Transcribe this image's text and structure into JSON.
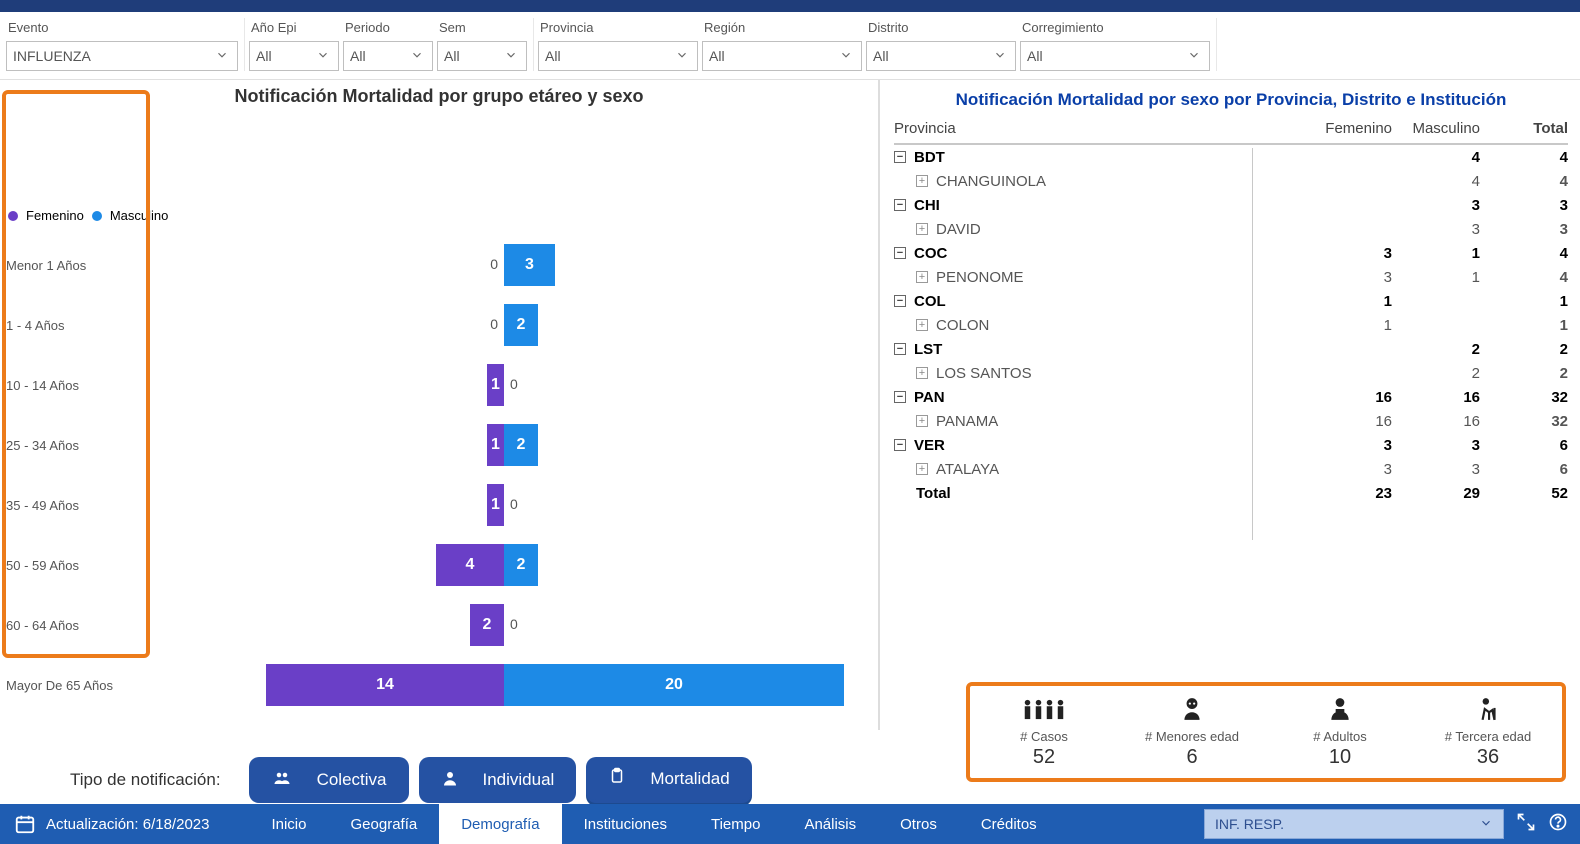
{
  "filters": {
    "evento": {
      "label": "Evento",
      "value": "INFLUENZA"
    },
    "ano": {
      "label": "Año Epi",
      "value": "All"
    },
    "periodo": {
      "label": "Periodo",
      "value": "All"
    },
    "sem": {
      "label": "Sem",
      "value": "All"
    },
    "provincia": {
      "label": "Provincia",
      "value": "All"
    },
    "region": {
      "label": "Región",
      "value": "All"
    },
    "distrito": {
      "label": "Distrito",
      "value": "All"
    },
    "corregimiento": {
      "label": "Corregimiento",
      "value": "All"
    }
  },
  "chart_title": "Notificación Mortalidad por grupo etáreo y sexo",
  "legend": {
    "f": "Femenino",
    "m": "Masculino"
  },
  "chart_data": {
    "type": "bar",
    "orientation": "diverging-horizontal",
    "title": "Notificación Mortalidad por grupo etáreo y sexo",
    "xlabel": "",
    "ylabel": "",
    "categories": [
      "Menor 1 Años",
      "1 - 4 Años",
      "10 - 14 Años",
      "25 - 34 Años",
      "35 - 49 Años",
      "50 - 59 Años",
      "60 - 64 Años",
      "Mayor De 65 Años"
    ],
    "series": [
      {
        "name": "Femenino",
        "color": "#6a3fc7",
        "values": [
          0,
          0,
          1,
          1,
          1,
          4,
          2,
          14
        ]
      },
      {
        "name": "Masculino",
        "color": "#1d8ae6",
        "values": [
          3,
          2,
          0,
          2,
          0,
          2,
          0,
          20
        ]
      }
    ]
  },
  "table_title": "Notificación Mortalidad por sexo por Provincia, Distrito e Institución",
  "table_headers": {
    "c1": "Provincia",
    "c2": "Femenino",
    "c3": "Masculino",
    "c4": "Total"
  },
  "table_rows": [
    {
      "lvl": 1,
      "name": "BDT",
      "f": "",
      "m": "4",
      "t": "4"
    },
    {
      "lvl": 2,
      "name": "CHANGUINOLA",
      "f": "",
      "m": "4",
      "t": "4"
    },
    {
      "lvl": 1,
      "name": "CHI",
      "f": "",
      "m": "3",
      "t": "3"
    },
    {
      "lvl": 2,
      "name": "DAVID",
      "f": "",
      "m": "3",
      "t": "3"
    },
    {
      "lvl": 1,
      "name": "COC",
      "f": "3",
      "m": "1",
      "t": "4"
    },
    {
      "lvl": 2,
      "name": "PENONOME",
      "f": "3",
      "m": "1",
      "t": "4"
    },
    {
      "lvl": 1,
      "name": "COL",
      "f": "1",
      "m": "",
      "t": "1"
    },
    {
      "lvl": 2,
      "name": "COLON",
      "f": "1",
      "m": "",
      "t": "1"
    },
    {
      "lvl": 1,
      "name": "LST",
      "f": "",
      "m": "2",
      "t": "2"
    },
    {
      "lvl": 2,
      "name": "LOS SANTOS",
      "f": "",
      "m": "2",
      "t": "2"
    },
    {
      "lvl": 1,
      "name": "PAN",
      "f": "16",
      "m": "16",
      "t": "32"
    },
    {
      "lvl": 2,
      "name": "PANAMA",
      "f": "16",
      "m": "16",
      "t": "32"
    },
    {
      "lvl": 1,
      "name": "VER",
      "f": "3",
      "m": "3",
      "t": "6"
    },
    {
      "lvl": 2,
      "name": "ATALAYA",
      "f": "3",
      "m": "3",
      "t": "6"
    },
    {
      "lvl": 1,
      "name": "Total",
      "f": "23",
      "m": "29",
      "t": "52",
      "is_total": true
    }
  ],
  "notif": {
    "label": "Tipo de notificación:",
    "colectiva": "Colectiva",
    "individual": "Individual",
    "mortalidad": "Mortalidad"
  },
  "kpi": {
    "casos": {
      "label": "# Casos",
      "value": "52"
    },
    "menores": {
      "label": "# Menores edad",
      "value": "6"
    },
    "adultos": {
      "label": "# Adultos",
      "value": "10"
    },
    "tercera": {
      "label": "# Tercera edad",
      "value": "36"
    }
  },
  "footer": {
    "update_label": "Actualización:",
    "update_date": "6/18/2023",
    "tabs": {
      "inicio": "Inicio",
      "geografia": "Geografía",
      "demografia": "Demografía",
      "instituciones": "Instituciones",
      "tiempo": "Tiempo",
      "analisis": "Análisis",
      "otros": "Otros",
      "creditos": "Créditos"
    },
    "dropdown": "INF. RESP."
  }
}
